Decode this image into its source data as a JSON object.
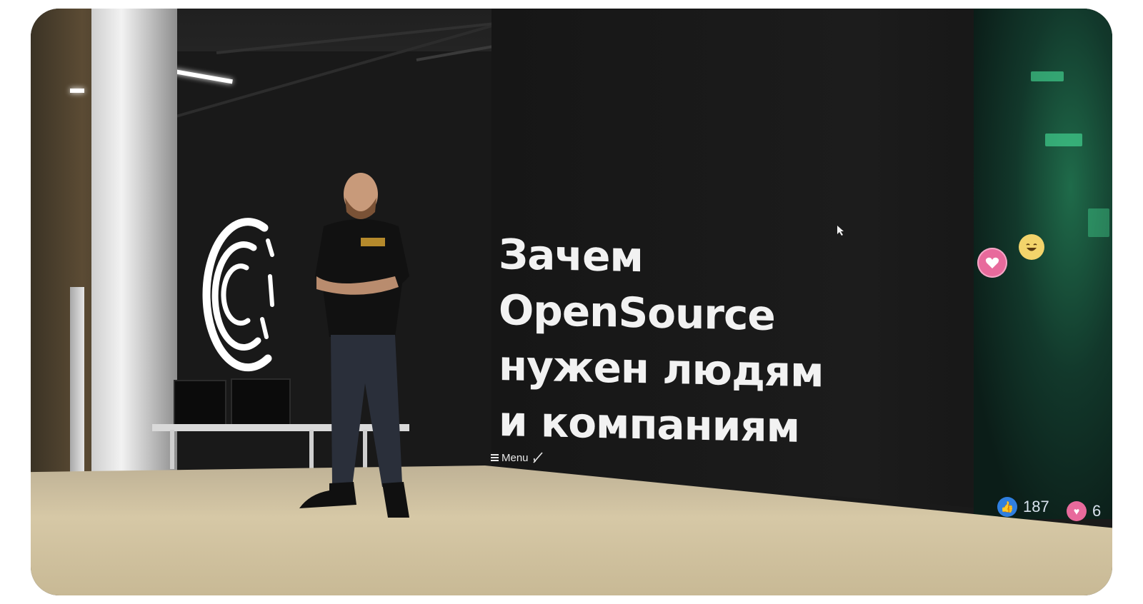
{
  "slide": {
    "title_lines": [
      "Зачем",
      "OpenSource",
      "нужен людям",
      "и компаниям"
    ],
    "menu_label": "Menu"
  },
  "reactions": {
    "likes_count": "187",
    "hearts_count": "6"
  },
  "icons": {
    "menu": "hamburger-icon",
    "brush": "brush-icon",
    "cursor": "mouse-cursor-icon",
    "like": "thumbs-up-icon",
    "heart": "heart-icon",
    "laugh": "laughing-emoji-icon"
  },
  "colors": {
    "like_blue": "#2f7fe0",
    "heart_pink": "#e86a9c",
    "slide_text": "#f2f2f2",
    "screen_background": "#1c1c1c"
  }
}
